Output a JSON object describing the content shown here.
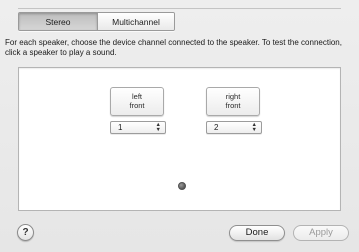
{
  "tabs": {
    "stereo_label": "Stereo",
    "multichannel_label": "Multichannel",
    "selected": "Stereo"
  },
  "instructions": "For each speaker, choose the device channel connected to the speaker. To test the connection, click a speaker to play a sound.",
  "speakers": {
    "left": {
      "label_line1": "left",
      "label_line2": "front",
      "channel": "1"
    },
    "right": {
      "label_line1": "right",
      "label_line2": "front",
      "channel": "2"
    }
  },
  "stepper_arrows": {
    "up": "▲",
    "down": "▼"
  },
  "listener_icon": "listener-dot",
  "help_label": "?",
  "buttons": {
    "done": "Done",
    "apply": "Apply"
  }
}
